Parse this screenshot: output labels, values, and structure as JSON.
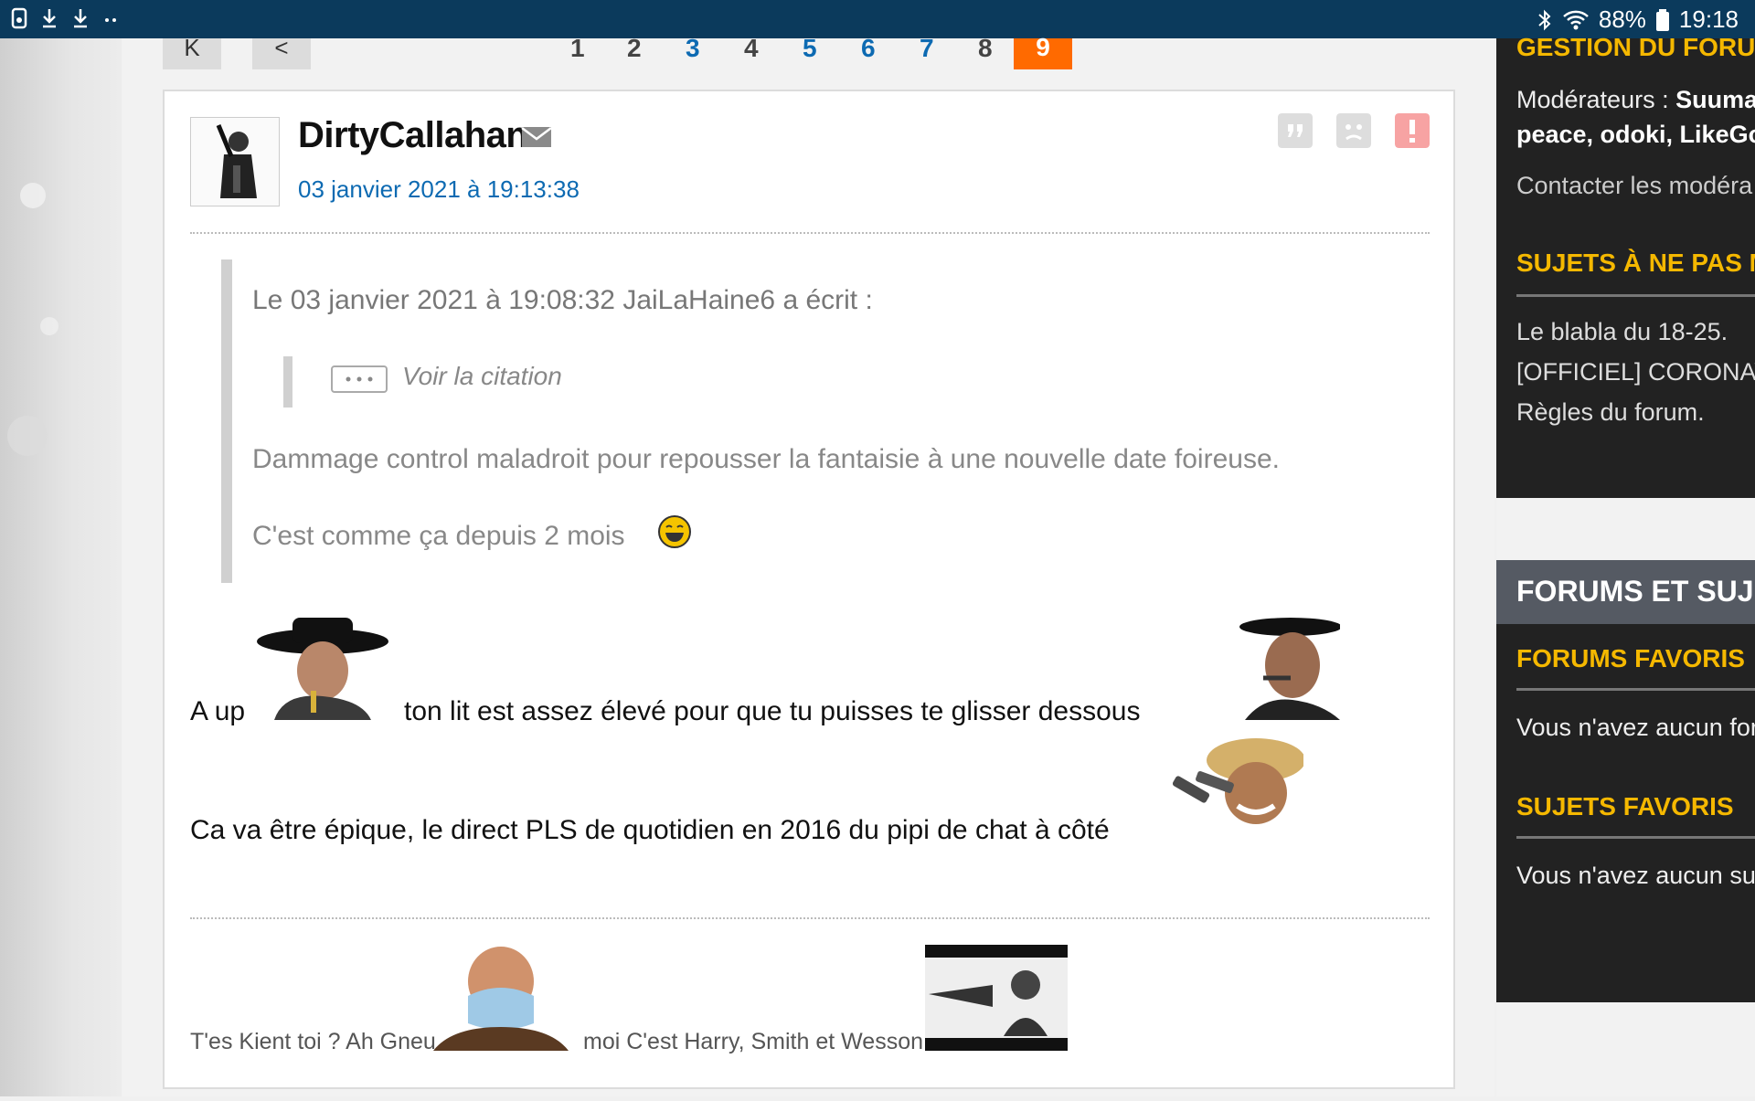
{
  "statusbar": {
    "battery": "88%",
    "time": "19:18"
  },
  "pager": {
    "first_label": "K",
    "prev_label": "<",
    "pages": [
      "1",
      "2",
      "3",
      "4",
      "5",
      "6",
      "7",
      "8"
    ],
    "current": "9"
  },
  "post": {
    "username": "DirtyCallahan",
    "date": "03 janvier 2021 à 19:13:38",
    "quote": {
      "header": "Le 03 janvier 2021 à 19:08:32 JaiLaHaine6 a écrit :",
      "toggle_label": "Voir la citation",
      "line1": "Dammage control maladroit pour repousser la fantaisie à une nouvelle date foireuse.",
      "line2": "C'est comme ça depuis 2 mois"
    },
    "body": {
      "line1_a": "A up",
      "line1_b": "ton lit est assez élevé pour que tu puisses te glisser dessous",
      "line2": "Ca va être épique, le direct PLS de quotidien en 2016 du pipi de chat à côté"
    },
    "signature": {
      "part1": "T'es Kient toi ? Ah Gneu",
      "part2": "moi C'est Harry, Smith et Wesson"
    }
  },
  "sidebar": {
    "gestion_title": "GESTION DU FORUM",
    "moderators_label": "Modérateurs : ",
    "moderators_line1": "Suuma",
    "moderators_line2": "peace, odoki, LikeGoo",
    "contact": "Contacter les modéra",
    "sujets_title": "SUJETS À NE PAS MA",
    "sujets": [
      "Le blabla du 18-25.",
      "[OFFICIEL] CORONAV",
      "Règles du forum."
    ],
    "forums_header": "FORUMS ET SUJET",
    "forums_fav_title": "FORUMS FAVORIS",
    "forums_fav_text": "Vous n'avez aucun for",
    "sujets_fav_title": "SUJETS FAVORIS",
    "sujets_fav_text": "Vous n'avez aucun su"
  }
}
